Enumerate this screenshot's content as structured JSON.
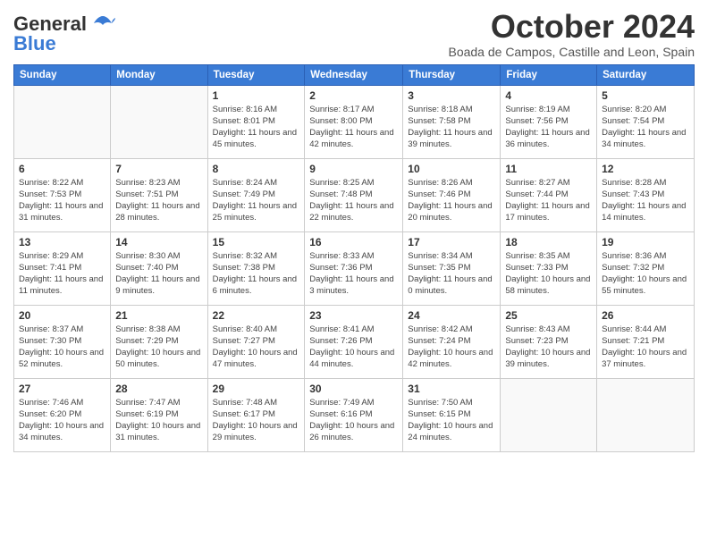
{
  "logo": {
    "line1": "General",
    "line2": "Blue"
  },
  "title": "October 2024",
  "subtitle": "Boada de Campos, Castille and Leon, Spain",
  "days_of_week": [
    "Sunday",
    "Monday",
    "Tuesday",
    "Wednesday",
    "Thursday",
    "Friday",
    "Saturday"
  ],
  "weeks": [
    [
      {
        "day": "",
        "info": ""
      },
      {
        "day": "",
        "info": ""
      },
      {
        "day": "1",
        "info": "Sunrise: 8:16 AM\nSunset: 8:01 PM\nDaylight: 11 hours and 45 minutes."
      },
      {
        "day": "2",
        "info": "Sunrise: 8:17 AM\nSunset: 8:00 PM\nDaylight: 11 hours and 42 minutes."
      },
      {
        "day": "3",
        "info": "Sunrise: 8:18 AM\nSunset: 7:58 PM\nDaylight: 11 hours and 39 minutes."
      },
      {
        "day": "4",
        "info": "Sunrise: 8:19 AM\nSunset: 7:56 PM\nDaylight: 11 hours and 36 minutes."
      },
      {
        "day": "5",
        "info": "Sunrise: 8:20 AM\nSunset: 7:54 PM\nDaylight: 11 hours and 34 minutes."
      }
    ],
    [
      {
        "day": "6",
        "info": "Sunrise: 8:22 AM\nSunset: 7:53 PM\nDaylight: 11 hours and 31 minutes."
      },
      {
        "day": "7",
        "info": "Sunrise: 8:23 AM\nSunset: 7:51 PM\nDaylight: 11 hours and 28 minutes."
      },
      {
        "day": "8",
        "info": "Sunrise: 8:24 AM\nSunset: 7:49 PM\nDaylight: 11 hours and 25 minutes."
      },
      {
        "day": "9",
        "info": "Sunrise: 8:25 AM\nSunset: 7:48 PM\nDaylight: 11 hours and 22 minutes."
      },
      {
        "day": "10",
        "info": "Sunrise: 8:26 AM\nSunset: 7:46 PM\nDaylight: 11 hours and 20 minutes."
      },
      {
        "day": "11",
        "info": "Sunrise: 8:27 AM\nSunset: 7:44 PM\nDaylight: 11 hours and 17 minutes."
      },
      {
        "day": "12",
        "info": "Sunrise: 8:28 AM\nSunset: 7:43 PM\nDaylight: 11 hours and 14 minutes."
      }
    ],
    [
      {
        "day": "13",
        "info": "Sunrise: 8:29 AM\nSunset: 7:41 PM\nDaylight: 11 hours and 11 minutes."
      },
      {
        "day": "14",
        "info": "Sunrise: 8:30 AM\nSunset: 7:40 PM\nDaylight: 11 hours and 9 minutes."
      },
      {
        "day": "15",
        "info": "Sunrise: 8:32 AM\nSunset: 7:38 PM\nDaylight: 11 hours and 6 minutes."
      },
      {
        "day": "16",
        "info": "Sunrise: 8:33 AM\nSunset: 7:36 PM\nDaylight: 11 hours and 3 minutes."
      },
      {
        "day": "17",
        "info": "Sunrise: 8:34 AM\nSunset: 7:35 PM\nDaylight: 11 hours and 0 minutes."
      },
      {
        "day": "18",
        "info": "Sunrise: 8:35 AM\nSunset: 7:33 PM\nDaylight: 10 hours and 58 minutes."
      },
      {
        "day": "19",
        "info": "Sunrise: 8:36 AM\nSunset: 7:32 PM\nDaylight: 10 hours and 55 minutes."
      }
    ],
    [
      {
        "day": "20",
        "info": "Sunrise: 8:37 AM\nSunset: 7:30 PM\nDaylight: 10 hours and 52 minutes."
      },
      {
        "day": "21",
        "info": "Sunrise: 8:38 AM\nSunset: 7:29 PM\nDaylight: 10 hours and 50 minutes."
      },
      {
        "day": "22",
        "info": "Sunrise: 8:40 AM\nSunset: 7:27 PM\nDaylight: 10 hours and 47 minutes."
      },
      {
        "day": "23",
        "info": "Sunrise: 8:41 AM\nSunset: 7:26 PM\nDaylight: 10 hours and 44 minutes."
      },
      {
        "day": "24",
        "info": "Sunrise: 8:42 AM\nSunset: 7:24 PM\nDaylight: 10 hours and 42 minutes."
      },
      {
        "day": "25",
        "info": "Sunrise: 8:43 AM\nSunset: 7:23 PM\nDaylight: 10 hours and 39 minutes."
      },
      {
        "day": "26",
        "info": "Sunrise: 8:44 AM\nSunset: 7:21 PM\nDaylight: 10 hours and 37 minutes."
      }
    ],
    [
      {
        "day": "27",
        "info": "Sunrise: 7:46 AM\nSunset: 6:20 PM\nDaylight: 10 hours and 34 minutes."
      },
      {
        "day": "28",
        "info": "Sunrise: 7:47 AM\nSunset: 6:19 PM\nDaylight: 10 hours and 31 minutes."
      },
      {
        "day": "29",
        "info": "Sunrise: 7:48 AM\nSunset: 6:17 PM\nDaylight: 10 hours and 29 minutes."
      },
      {
        "day": "30",
        "info": "Sunrise: 7:49 AM\nSunset: 6:16 PM\nDaylight: 10 hours and 26 minutes."
      },
      {
        "day": "31",
        "info": "Sunrise: 7:50 AM\nSunset: 6:15 PM\nDaylight: 10 hours and 24 minutes."
      },
      {
        "day": "",
        "info": ""
      },
      {
        "day": "",
        "info": ""
      }
    ]
  ]
}
